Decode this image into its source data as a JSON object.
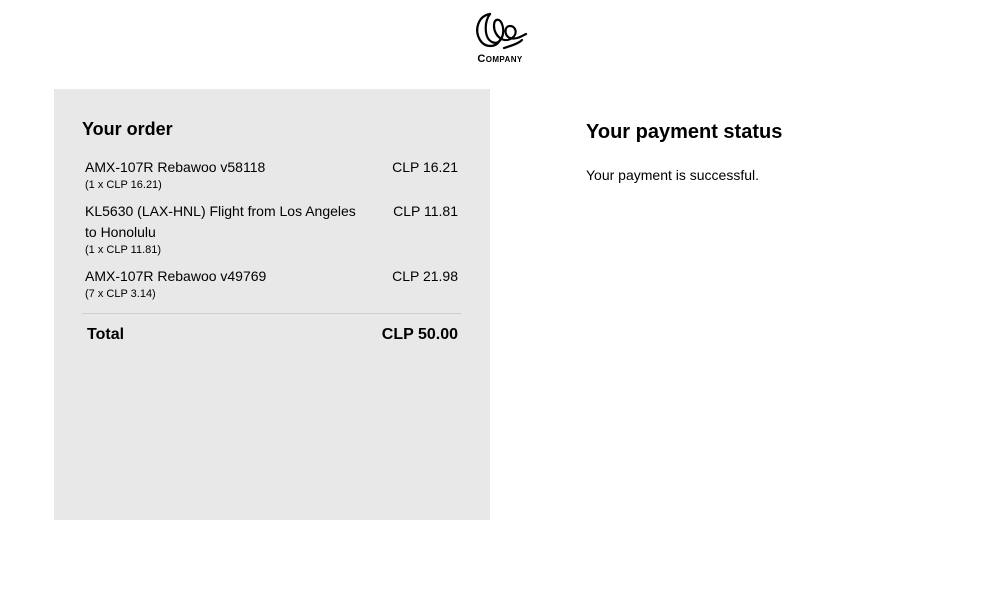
{
  "brand": {
    "logo_text": "Company",
    "logo_icon": "company-logo-icon"
  },
  "order": {
    "title": "Your order",
    "items": [
      {
        "name": "AMX-107R Rebawoo v58118",
        "price": "CLP 16.21",
        "qty": "(1 x CLP 16.21)"
      },
      {
        "name": "KL5630 (LAX-HNL) Flight from Los Angeles to Honolulu",
        "price": "CLP 11.81",
        "qty": "(1 x CLP 11.81)"
      },
      {
        "name": "AMX-107R Rebawoo v49769",
        "price": "CLP 21.98",
        "qty": "(7 x CLP 3.14)"
      }
    ],
    "total_label": "Total",
    "total_value": "CLP 50.00"
  },
  "status": {
    "title": "Your payment status",
    "message": "Your payment is successful."
  },
  "colors": {
    "panel_background": "#e8e8e8",
    "page_background": "#ffffff",
    "text": "#000000"
  }
}
